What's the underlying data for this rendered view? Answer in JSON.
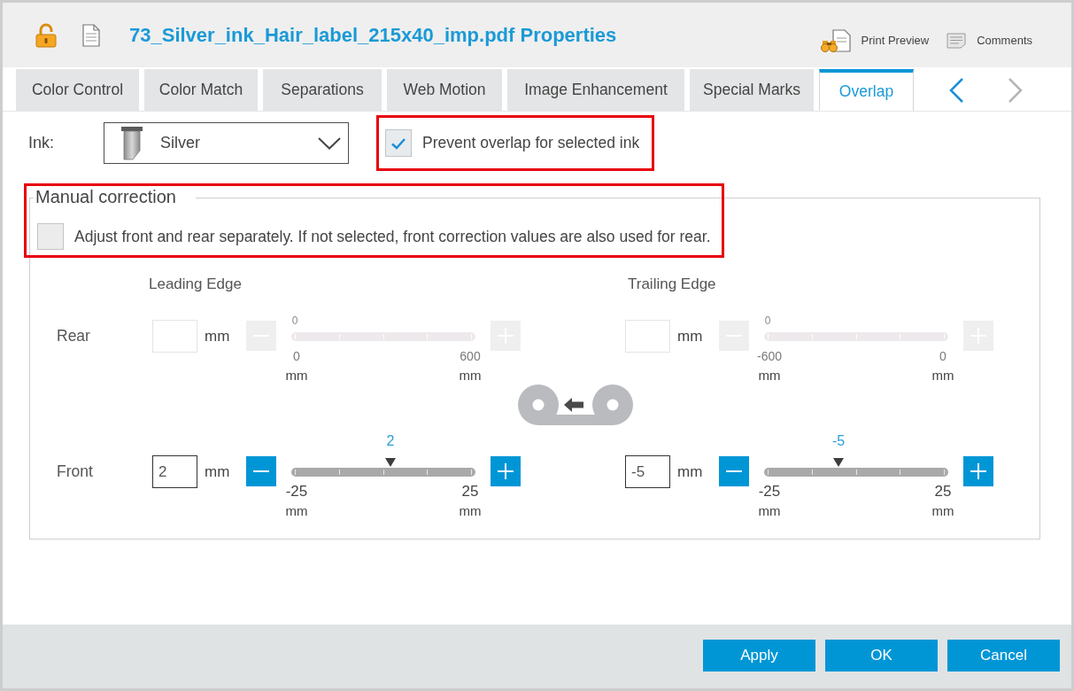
{
  "window": {
    "title": "73_Silver_ink_Hair_label_215x40_imp.pdf Properties"
  },
  "toolbar": [
    {
      "kind": "preview",
      "label": "Print Preview"
    },
    {
      "kind": "comments",
      "label": "Comments"
    }
  ],
  "tabs": [
    {
      "label": "Color Control",
      "selected": false
    },
    {
      "label": "Color Match",
      "selected": false
    },
    {
      "label": "Separations",
      "selected": false
    },
    {
      "label": "Web Motion",
      "selected": false
    },
    {
      "label": "Image Enhancement",
      "selected": false
    },
    {
      "label": "Special Marks",
      "selected": false
    },
    {
      "label": "Overlap",
      "selected": true
    }
  ],
  "tab_scroll": [
    {
      "kind": "previous",
      "disabled": false
    },
    {
      "kind": "next",
      "disabled": true
    }
  ],
  "ink": {
    "label": "Ink:",
    "value": "Silver"
  },
  "prevent_overlap": {
    "label": "Prevent overlap for selected ink",
    "checked": true,
    "highlighted": true
  },
  "manual_correction": {
    "title": "Manual correction",
    "highlighted": true,
    "separate": {
      "label": "Adjust front and rear separately. If not selected, front correction values are also used for rear.",
      "checked": false
    },
    "columns": [
      "Leading Edge",
      "Trailing Edge"
    ],
    "rows": [
      {
        "label": "Rear",
        "disabled": true,
        "edges": [
          {
            "unit": "mm",
            "value_label": "0",
            "min": "0",
            "max": "600",
            "min_unit": "mm",
            "max_unit": "mm"
          },
          {
            "unit": "mm",
            "value_label": "0",
            "min": "-600",
            "max": "0",
            "min_unit": "mm",
            "max_unit": "mm"
          }
        ]
      },
      {
        "label": "Front",
        "disabled": false,
        "edges": [
          {
            "value": "2",
            "unit": "mm",
            "value_label": "2",
            "level": 0.54,
            "min": "-25",
            "max": "25",
            "min_unit": "mm",
            "max_unit": "mm"
          },
          {
            "value": "-5",
            "unit": "mm",
            "value_label": "-5",
            "level": 0.4,
            "min": "-25",
            "max": "25",
            "min_unit": "mm",
            "max_unit": "mm"
          }
        ]
      }
    ]
  },
  "buttons": [
    "Apply",
    "OK",
    "Cancel"
  ]
}
